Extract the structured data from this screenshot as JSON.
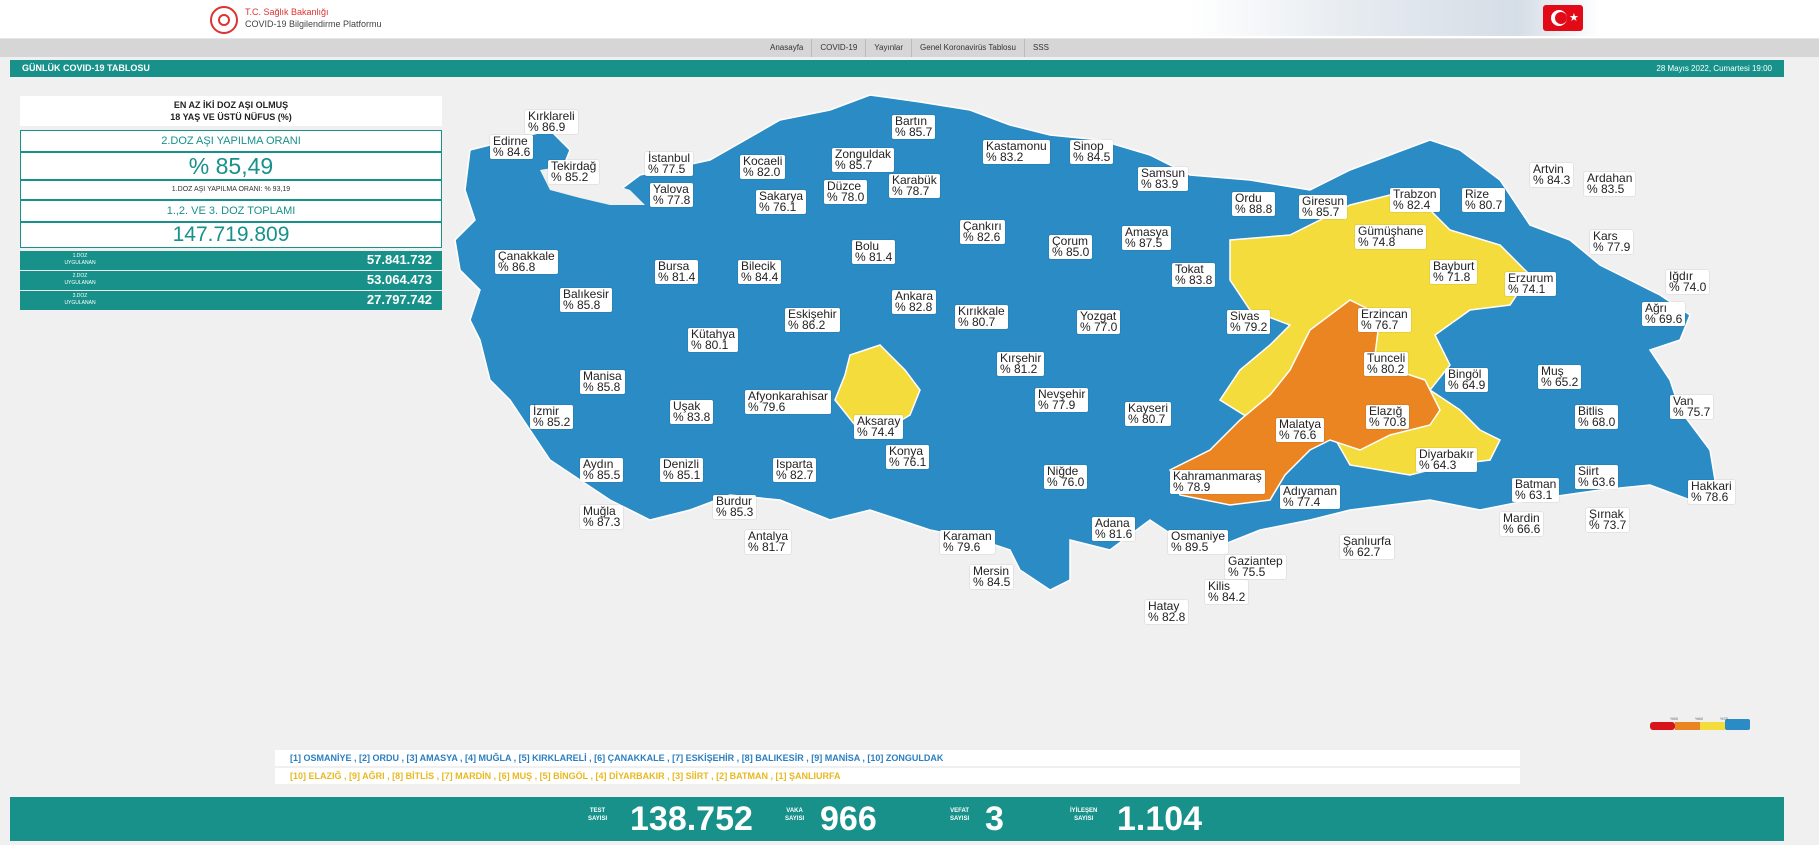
{
  "header": {
    "ministry": "T.C. Sağlık Bakanlığı",
    "platform": "COVID-19 Bilgilendirme Platformu"
  },
  "nav": [
    "Anasayfa",
    "COVID-19",
    "Yayınlar",
    "Genel Koronavirüs Tablosu",
    "SSS"
  ],
  "bar": {
    "title": "GÜNLÜK COVID-19 TABLOSU",
    "date": "28 Mayıs 2022, Cumartesi 19:00"
  },
  "panel": {
    "title_line1": "EN AZ İKİ DOZ AŞI OLMUŞ",
    "title_line2": "18 YAŞ VE ÜSTÜ NÜFUS (%)",
    "second_dose_label": "2.DOZ AŞI YAPILMA ORANI",
    "second_dose_value": "% 85,49",
    "first_dose_note": "1.DOZ AŞI YAPILMA ORANI: % 93,19",
    "total_label": "1.,2. VE 3. DOZ TOPLAMI",
    "total_value": "147.719.809",
    "doses": [
      {
        "label1": "1.DOZ",
        "label2": "UYGULANAN",
        "value": "57.841.732"
      },
      {
        "label1": "2.DOZ",
        "label2": "UYGULANAN",
        "value": "53.064.473"
      },
      {
        "label1": "3.DOZ",
        "label2": "UYGULANAN",
        "value": "27.797.742"
      }
    ]
  },
  "map": {
    "colors": {
      "blue": "#2b8bc4",
      "yellow": "#f4dc3c",
      "orange": "#ea8522",
      "red": "#d8141b"
    },
    "scale_labels": [
      "%50",
      "%60",
      "%70"
    ],
    "provinces": [
      {
        "name": "Kırklareli",
        "value": "% 86.9"
      },
      {
        "name": "Edirne",
        "value": "% 84.6"
      },
      {
        "name": "Tekirdağ",
        "value": "% 85.2"
      },
      {
        "name": "İstanbul",
        "value": "% 77.5"
      },
      {
        "name": "Kocaeli",
        "value": "% 82.0"
      },
      {
        "name": "Yalova",
        "value": "% 77.8"
      },
      {
        "name": "Sakarya",
        "value": "% 76.1"
      },
      {
        "name": "Düzce",
        "value": "% 78.0"
      },
      {
        "name": "Zonguldak",
        "value": "% 85.7"
      },
      {
        "name": "Bartın",
        "value": "% 85.7"
      },
      {
        "name": "Karabük",
        "value": "% 78.7"
      },
      {
        "name": "Kastamonu",
        "value": "% 83.2"
      },
      {
        "name": "Sinop",
        "value": "% 84.5"
      },
      {
        "name": "Samsun",
        "value": "% 83.9"
      },
      {
        "name": "Ordu",
        "value": "% 88.8"
      },
      {
        "name": "Giresun",
        "value": "% 85.7"
      },
      {
        "name": "Trabzon",
        "value": "% 82.4"
      },
      {
        "name": "Rize",
        "value": "% 80.7"
      },
      {
        "name": "Artvin",
        "value": "% 84.3"
      },
      {
        "name": "Ardahan",
        "value": "% 83.5"
      },
      {
        "name": "Kars",
        "value": "% 77.9"
      },
      {
        "name": "Iğdır",
        "value": "% 74.0"
      },
      {
        "name": "Ağrı",
        "value": "% 69.6"
      },
      {
        "name": "Erzurum",
        "value": "% 74.1"
      },
      {
        "name": "Bayburt",
        "value": "% 71.8"
      },
      {
        "name": "Gümüşhane",
        "value": "% 74.8"
      },
      {
        "name": "Çanakkale",
        "value": "% 86.8"
      },
      {
        "name": "Balıkesir",
        "value": "% 85.8"
      },
      {
        "name": "Bursa",
        "value": "% 81.4"
      },
      {
        "name": "Bilecik",
        "value": "% 84.4"
      },
      {
        "name": "Bolu",
        "value": "% 81.4"
      },
      {
        "name": "Çankırı",
        "value": "% 82.6"
      },
      {
        "name": "Çorum",
        "value": "% 85.0"
      },
      {
        "name": "Amasya",
        "value": "% 87.5"
      },
      {
        "name": "Tokat",
        "value": "% 83.8"
      },
      {
        "name": "Erzincan",
        "value": "% 76.7"
      },
      {
        "name": "Eskişehir",
        "value": "% 86.2"
      },
      {
        "name": "Ankara",
        "value": "% 82.8"
      },
      {
        "name": "Kırıkkale",
        "value": "% 80.7"
      },
      {
        "name": "Yozgat",
        "value": "% 77.0"
      },
      {
        "name": "Sivas",
        "value": "% 79.2"
      },
      {
        "name": "Kütahya",
        "value": "% 80.1"
      },
      {
        "name": "Kırşehir",
        "value": "% 81.2"
      },
      {
        "name": "Tunceli",
        "value": "% 80.2"
      },
      {
        "name": "Bingöl",
        "value": "% 64.9"
      },
      {
        "name": "Muş",
        "value": "% 65.2"
      },
      {
        "name": "Manisa",
        "value": "% 85.8"
      },
      {
        "name": "Uşak",
        "value": "% 83.8"
      },
      {
        "name": "Afyonkarahisar",
        "value": "% 79.6"
      },
      {
        "name": "Nevşehir",
        "value": "% 77.9"
      },
      {
        "name": "Aksaray",
        "value": "% 74.4"
      },
      {
        "name": "Kayseri",
        "value": "% 80.7"
      },
      {
        "name": "Malatya",
        "value": "% 76.6"
      },
      {
        "name": "Elazığ",
        "value": "% 70.8"
      },
      {
        "name": "Bitlis",
        "value": "% 68.0"
      },
      {
        "name": "Van",
        "value": "% 75.7"
      },
      {
        "name": "İzmir",
        "value": "% 85.2"
      },
      {
        "name": "Konya",
        "value": "% 76.1"
      },
      {
        "name": "Diyarbakır",
        "value": "% 64.3"
      },
      {
        "name": "Aydın",
        "value": "% 85.5"
      },
      {
        "name": "Denizli",
        "value": "% 85.1"
      },
      {
        "name": "Isparta",
        "value": "% 82.7"
      },
      {
        "name": "Niğde",
        "value": "% 76.0"
      },
      {
        "name": "Kahramanmaraş",
        "value": "% 78.9"
      },
      {
        "name": "Adıyaman",
        "value": "% 77.4"
      },
      {
        "name": "Batman",
        "value": "% 63.1"
      },
      {
        "name": "Siirt",
        "value": "% 63.6"
      },
      {
        "name": "Hakkari",
        "value": "% 78.6"
      },
      {
        "name": "Burdur",
        "value": "% 85.3"
      },
      {
        "name": "Muğla",
        "value": "% 87.3"
      },
      {
        "name": "Antalya",
        "value": "% 81.7"
      },
      {
        "name": "Karaman",
        "value": "% 79.6"
      },
      {
        "name": "Adana",
        "value": "% 81.6"
      },
      {
        "name": "Osmaniye",
        "value": "% 89.5"
      },
      {
        "name": "Şanlıurfa",
        "value": "% 62.7"
      },
      {
        "name": "Mardin",
        "value": "% 66.6"
      },
      {
        "name": "Şırnak",
        "value": "% 73.7"
      },
      {
        "name": "Mersin",
        "value": "% 84.5"
      },
      {
        "name": "Gaziantep",
        "value": "% 75.5"
      },
      {
        "name": "Kilis",
        "value": "% 84.2"
      },
      {
        "name": "Hatay",
        "value": "% 82.8"
      }
    ]
  },
  "legend": {
    "top_ten": "[1] OSMANİYE , [2] ORDU , [3] AMASYA , [4] MUĞLA , [5] KIRKLARELİ , [6] ÇANAKKALE , [7] ESKİŞEHİR , [8] BALIKESİR , [9] MANİSA , [10] ZONGULDAK",
    "bottom_ten": "[10] ELAZIĞ , [9] AĞRI , [8] BİTLİS , [7] MARDİN , [6] MUŞ , [5] BİNGÖL , [4] DİYARBAKIR , [3] SİİRT , [2] BATMAN , [1] ŞANLIURFA"
  },
  "stats": [
    {
      "label1": "TEST",
      "label2": "SAYISI",
      "value": "138.752"
    },
    {
      "label1": "VAKA",
      "label2": "SAYISI",
      "value": "966"
    },
    {
      "label1": "VEFAT",
      "label2": "SAYISI",
      "value": "3"
    },
    {
      "label1": "İYİLEŞEN",
      "label2": "SAYISI",
      "value": "1.104"
    }
  ]
}
